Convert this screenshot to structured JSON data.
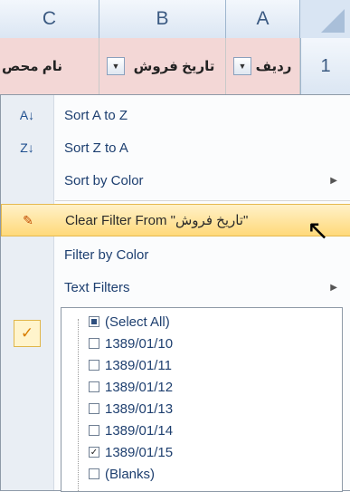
{
  "columns": [
    "C",
    "B",
    "A"
  ],
  "row_number": "1",
  "cells": {
    "c": "نام محص",
    "b": "تاریخ فروش",
    "a": "ردیف"
  },
  "menu": {
    "items": [
      {
        "label": "Sort A to Z",
        "icon": "sort-az-icon"
      },
      {
        "label": "Sort Z to A",
        "icon": "sort-za-icon"
      },
      {
        "label": "Sort by Color",
        "icon": "",
        "submenu": true
      },
      {
        "label": "Clear Filter From \"تاریخ فروش\"",
        "icon": "clear-filter-icon"
      },
      {
        "label": "Filter by Color",
        "icon": ""
      },
      {
        "label": "Text Filters",
        "icon": "",
        "submenu": true
      }
    ]
  },
  "checklist": {
    "items": [
      {
        "label": "(Select All)",
        "state": "indeterminate"
      },
      {
        "label": "1389/01/10",
        "state": "unchecked"
      },
      {
        "label": "1389/01/11",
        "state": "unchecked"
      },
      {
        "label": "1389/01/12",
        "state": "unchecked"
      },
      {
        "label": "1389/01/13",
        "state": "unchecked"
      },
      {
        "label": "1389/01/14",
        "state": "unchecked"
      },
      {
        "label": "1389/01/15",
        "state": "checked"
      },
      {
        "label": "(Blanks)",
        "state": "unchecked"
      }
    ]
  }
}
